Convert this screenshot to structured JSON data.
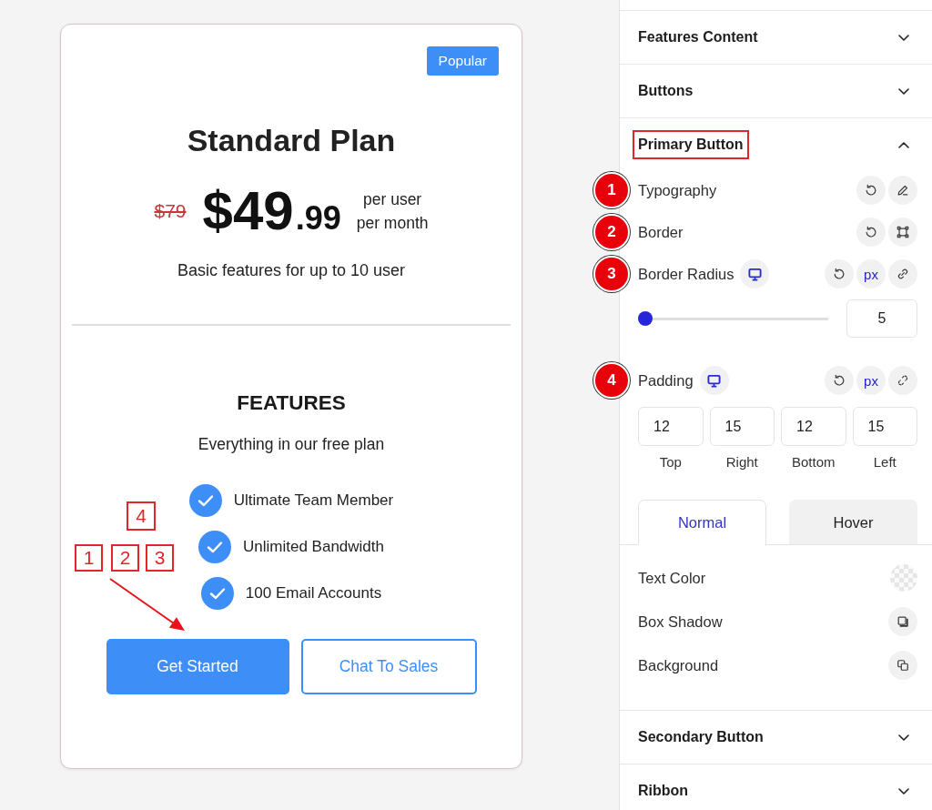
{
  "pricing_card": {
    "badge": "Popular",
    "title": "Standard Plan",
    "old_price": "$79",
    "price": "$49",
    "cents": ".99",
    "period": [
      "per user",
      "per month"
    ],
    "description": "Basic features for up to 10 user",
    "features_heading": "FEATURES",
    "features_subtitle": "Everything in our free plan",
    "features": [
      "Ultimate Team Member",
      "Unlimited Bandwidth",
      "100 Email Accounts"
    ],
    "buttons": [
      {
        "label": "Get Started",
        "kind": "primary"
      },
      {
        "label": "Chat To Sales",
        "kind": "outline"
      }
    ],
    "callout_boxes": [
      "1",
      "2",
      "3",
      "4"
    ]
  },
  "settings_panel": {
    "sections": [
      {
        "title": "Features Content",
        "expanded": false,
        "highlighted": false
      },
      {
        "title": "Buttons",
        "expanded": false,
        "highlighted": false
      },
      {
        "title": "Primary Button",
        "expanded": true,
        "highlighted": true,
        "controls": [
          {
            "kind": "row",
            "label": "Typography",
            "callout": "1",
            "responsive": false,
            "actions": [
              {
                "kind": "reset"
              },
              {
                "kind": "edit"
              }
            ]
          },
          {
            "kind": "row",
            "label": "Border",
            "callout": "2",
            "responsive": false,
            "actions": [
              {
                "kind": "reset"
              },
              {
                "kind": "border"
              }
            ]
          },
          {
            "kind": "slider",
            "label": "Border Radius",
            "callout": "3",
            "responsive": true,
            "actions": [
              {
                "kind": "reset"
              },
              {
                "kind": "unit",
                "label": "px"
              },
              {
                "kind": "link"
              }
            ],
            "level": 0.04,
            "value": "5"
          },
          {
            "kind": "dimensions",
            "label": "Padding",
            "callout": "4",
            "responsive": true,
            "actions": [
              {
                "kind": "reset"
              },
              {
                "kind": "unit",
                "label": "px"
              },
              {
                "kind": "unlink"
              }
            ],
            "fields": [
              {
                "value": "12",
                "label": "Top"
              },
              {
                "value": "15",
                "label": "Right"
              },
              {
                "value": "12",
                "label": "Bottom"
              },
              {
                "value": "15",
                "label": "Left"
              }
            ]
          },
          {
            "kind": "tabs",
            "tabs": [
              {
                "label": "Normal",
                "selected": true
              },
              {
                "label": "Hover",
                "selected": false
              }
            ]
          },
          {
            "kind": "color",
            "label": "Text Color"
          },
          {
            "kind": "shadow",
            "label": "Box Shadow"
          },
          {
            "kind": "background",
            "label": "Background"
          }
        ]
      },
      {
        "title": "Secondary Button",
        "expanded": false,
        "highlighted": false
      },
      {
        "title": "Ribbon",
        "expanded": false,
        "highlighted": false
      }
    ]
  }
}
